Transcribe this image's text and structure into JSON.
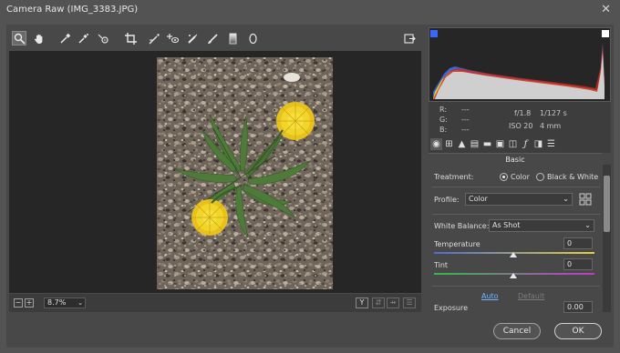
{
  "window": {
    "title": "Camera Raw (IMG_3383.JPG)",
    "close_glyph": "✕"
  },
  "toolbar": {
    "tools": [
      "zoom-tool",
      "hand-tool",
      "white-balance-tool",
      "color-sampler-tool",
      "targeted-adjustment-tool",
      "crop-tool",
      "straighten-tool",
      "red-eye-tool",
      "spot-removal-tool",
      "adjustment-brush-tool",
      "graduated-filter-tool",
      "radial-filter-tool"
    ],
    "open_preferences": "open-panel-icon"
  },
  "status": {
    "zoom_value": "8.7%",
    "zoom_minus": "−",
    "zoom_plus": "+",
    "dd": "⌄",
    "y_label": "Y"
  },
  "info": {
    "r_label": "R:",
    "g_label": "G:",
    "b_label": "B:",
    "r_value": "---",
    "g_value": "---",
    "b_value": "---",
    "aperture": "f/1.8",
    "shutter": "1/127 s",
    "iso": "ISO 20",
    "focal": "4 mm"
  },
  "panel": {
    "title": "Basic",
    "treatment_label": "Treatment:",
    "treatment_color": "Color",
    "treatment_bw": "Black & White",
    "profile_label": "Profile:",
    "profile_value": "Color",
    "wb_label": "White Balance:",
    "wb_value": "As Shot",
    "temperature_label": "Temperature",
    "temperature_value": "0",
    "tint_label": "Tint",
    "tint_value": "0",
    "auto_label": "Auto",
    "default_label": "Default",
    "exposure_label": "Exposure",
    "exposure_value": "0.00"
  },
  "buttons": {
    "cancel": "Cancel",
    "ok": "OK"
  },
  "colors": {
    "accent_link": "#6eb6ff",
    "disabled_link": "#7a7a7a"
  }
}
